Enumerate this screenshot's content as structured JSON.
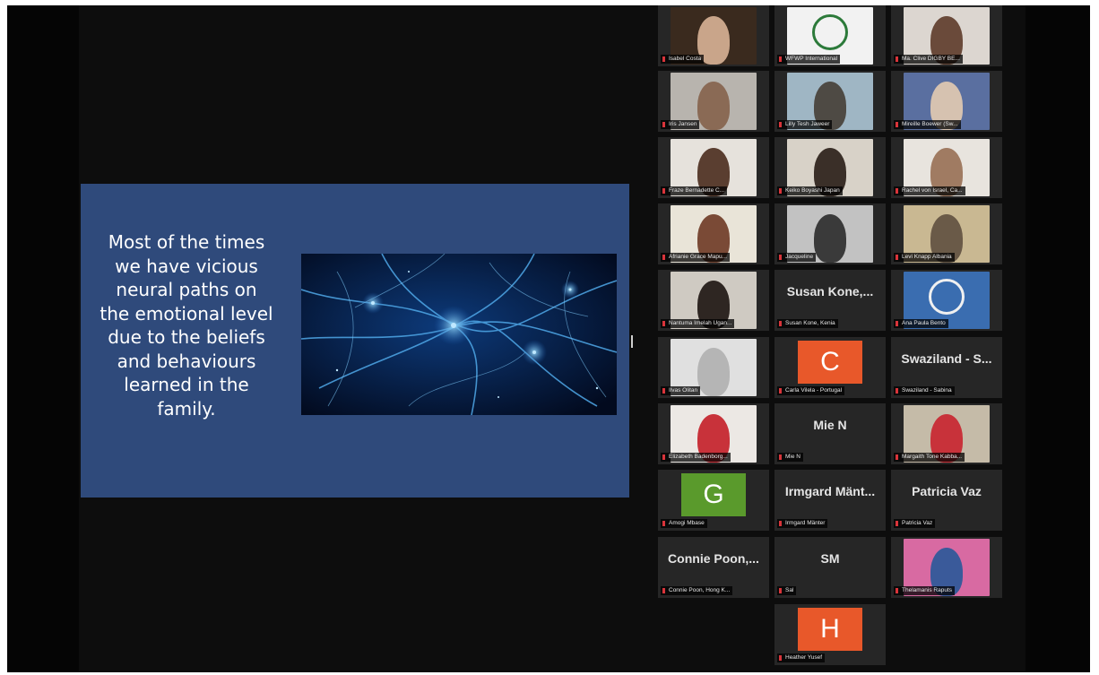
{
  "meeting": {
    "slide": {
      "text": "Most of the times\nwe have vicious\nneural paths on\nthe emotional level\ndue to the beliefs\nand behaviours\nlearned in the\nfamily."
    },
    "participants": [
      {
        "label": "Isabel Costa",
        "bg": "#3a2a1e",
        "fg": "#c9a58a",
        "kind": "video"
      },
      {
        "label": "WFWP International",
        "bg": "#f2f2f2",
        "fg": "#2c7a3a",
        "kind": "logo"
      },
      {
        "label": "Ma. Clive DIGBY BE...",
        "bg": "#dcd6d0",
        "fg": "#6a4a3a",
        "kind": "video"
      },
      {
        "label": "Iris Jansen",
        "bg": "#b8b4ae",
        "fg": "#8a6a55",
        "kind": "video"
      },
      {
        "label": "Lilly Tesh Jaweer",
        "bg": "#9fb6c4",
        "fg": "#4e4a44",
        "kind": "video"
      },
      {
        "label": "Mireille Boewer (Sw...",
        "bg": "#5a6fa0",
        "fg": "#d6c2b0",
        "kind": "video"
      },
      {
        "label": "Fraze Bernadette C...",
        "bg": "#e6e2dc",
        "fg": "#5a3e30",
        "kind": "video"
      },
      {
        "label": "Keiko Boyashi Japan",
        "bg": "#d8d2c8",
        "fg": "#3a2f28",
        "kind": "video"
      },
      {
        "label": "Rachel von Israel, Ca...",
        "bg": "#e8e4de",
        "fg": "#a07b62",
        "kind": "video"
      },
      {
        "label": "Afrianie Grace Mapu...",
        "bg": "#e9e4d8",
        "fg": "#7a4a36",
        "kind": "video"
      },
      {
        "label": "Jacqueline",
        "bg": "#c2c2c2",
        "fg": "#3a3a3a",
        "kind": "video"
      },
      {
        "label": "Levi Knapp Albania",
        "bg": "#c9b892",
        "fg": "#6a5a48",
        "kind": "video"
      },
      {
        "label": "Nantuma Imelah Ugan...",
        "bg": "#cfcac2",
        "fg": "#2e2622",
        "kind": "video"
      },
      {
        "label": "Susan Kone, Kenia",
        "name": "Susan Kone,...",
        "kind": "name"
      },
      {
        "label": "Ana Paula Bento",
        "bg": "#3a6db0",
        "fg": "#f0f0f0",
        "kind": "logo"
      },
      {
        "label": "Ilvas Olitan",
        "bg": "#e0e0e0",
        "fg": "#b5b5b5",
        "kind": "video"
      },
      {
        "label": "Carla Vilela - Portugal",
        "letter": "C",
        "color": "#e8582a",
        "kind": "avatar"
      },
      {
        "label": "Swaziland - Sabina",
        "name": "Swaziland - S...",
        "kind": "name"
      },
      {
        "label": "Elizabeth Badenborg...",
        "bg": "#ece8e4",
        "fg": "#c8323a",
        "kind": "video"
      },
      {
        "label": "Mie N",
        "name": "Mie N",
        "kind": "name"
      },
      {
        "label": "Margaith Tone Kabba...",
        "bg": "#c5bba8",
        "fg": "#c8323a",
        "kind": "video"
      },
      {
        "label": "Amogi Mbase",
        "letter": "G",
        "color": "#5a9a2c",
        "kind": "avatar"
      },
      {
        "label": "Irmgard Mänter",
        "name": "Irmgard Mänt...",
        "kind": "name"
      },
      {
        "label": "Patricia Vaz",
        "name": "Patricia Vaz",
        "kind": "name"
      },
      {
        "label": "Connie Poon, Hong K...",
        "name": "Connie Poon,...",
        "kind": "name"
      },
      {
        "label": "Sal",
        "name": "SM",
        "kind": "name"
      },
      {
        "label": "Thelamanis Raputs",
        "bg": "#d86aa2",
        "fg": "#3a5a9a",
        "kind": "video"
      },
      {
        "label": "Heather Yusef",
        "letter": "H",
        "color": "#e8582a",
        "kind": "avatar"
      }
    ]
  }
}
